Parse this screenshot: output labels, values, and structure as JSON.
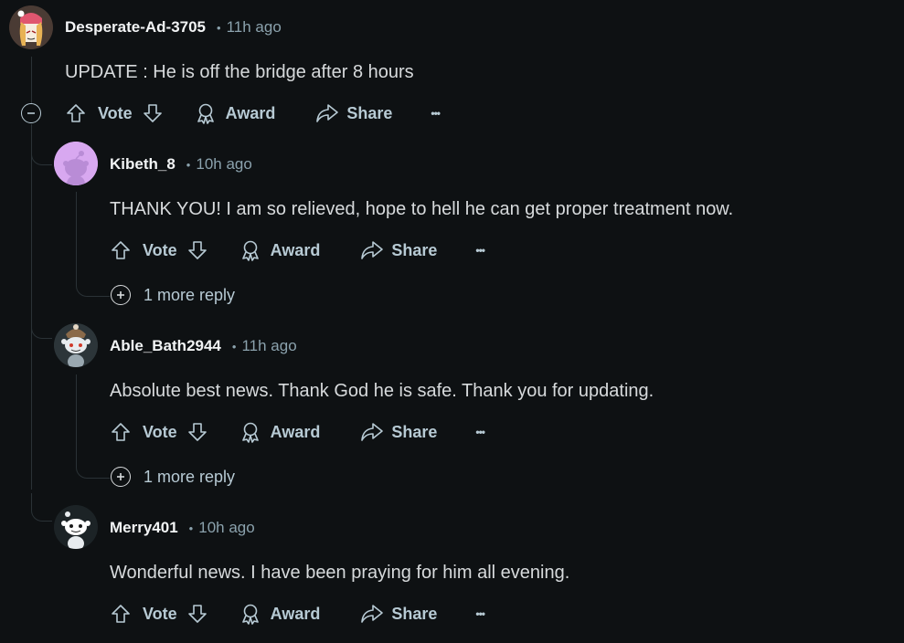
{
  "comments": [
    {
      "username": "Desperate-Ad-3705",
      "time": "11h ago",
      "body": "UPDATE : He is off the bridge after 8 hours"
    },
    {
      "username": "Kibeth_8",
      "time": "10h ago",
      "body": "THANK YOU! I am so relieved, hope to hell he can get proper treatment now.",
      "more_replies": "1 more reply"
    },
    {
      "username": "Able_Bath2944",
      "time": "11h ago",
      "body": "Absolute best news. Thank God he is safe. Thank you for updating.",
      "more_replies": "1 more reply"
    },
    {
      "username": "Merry401",
      "time": "10h ago",
      "body": "Wonderful news. I have been praying for him all evening."
    }
  ],
  "actions": {
    "vote": "Vote",
    "award": "Award",
    "share": "Share",
    "overflow": "•••"
  },
  "separator": "•",
  "colors": {
    "background": "#0e1113",
    "username": "#f2f4f5",
    "text": "#d7dadc",
    "muted": "#8ba2ad",
    "thread_line": "#2a3236",
    "avatar_kibeth": "#d8a8f0",
    "avatar_merry": "#e8ecef"
  },
  "icons": {
    "collapse": "minus-circle-icon",
    "expand": "plus-circle-icon",
    "upvote": "arrow-up-icon",
    "downvote": "arrow-down-icon",
    "award": "award-ribbon-icon",
    "share": "share-arrow-icon",
    "overflow": "ellipsis-icon"
  }
}
